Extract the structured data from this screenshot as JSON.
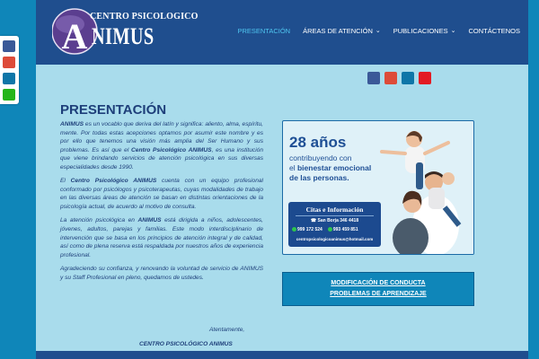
{
  "header": {
    "logo": {
      "line1": "CENTRO PSICOLOGICO",
      "line2": "NIMUS",
      "monogram": "A"
    },
    "nav": [
      {
        "label": "PRESENTACIÓN",
        "active": true
      },
      {
        "label": "ÁREAS DE ATENCIÓN",
        "dropdown": true
      },
      {
        "label": "PUBLICACIONES",
        "dropdown": true
      },
      {
        "label": "CONTÁCTENOS"
      }
    ]
  },
  "social": {
    "icons": [
      "facebook-icon",
      "google-plus-icon",
      "linkedin-icon",
      "youtube-icon"
    ],
    "colors": [
      "#3b5998",
      "#dd4b39",
      "#0e76a8",
      "#e31b23"
    ]
  },
  "share_bar": {
    "icons": [
      "facebook-icon",
      "google-plus-icon",
      "linkedin-icon",
      "whatsapp-icon"
    ],
    "colors": [
      "#3b5998",
      "#dd4b39",
      "#0e76a8",
      "#25b51a"
    ]
  },
  "main": {
    "heading": "PRESENTACIÓN",
    "p1_a": "ANIMUS",
    "p1_b": " es un vocablo que deriva del latín y significa: aliento, alma, espíritu, mente. Por todas estas acepciones optamos por asumir este nombre y es por ello que tenemos una visión más amplia del  Ser Humano y sus problemas.  Es así que el ",
    "p1_c": "Centro Psicológico ANIMUS",
    "p1_d": ", es una institución que viene brindando servicios de atención psicológica en sus diversas especialidades desde 1990.",
    "p2_a": "El ",
    "p2_b": "Centro Psicológico ANIMUS",
    "p2_c": " cuenta con un equipo profesional conformado por psicólogos y psicoterapeutas, cuyas modalidades de trabajo en las diversas áreas de atención se basan en distintas orientaciones de la psicología actual, de acuerdo al motivo de consulta.",
    "p3_a": "La atención psicológica en ",
    "p3_b": "ANIMUS",
    "p3_c": " está dirigida a niños, adolescentes, jóvenes, adultos, parejas y familias. Este modo interdisciplinario de  intervención  que se basa en los  principios de  atención  integral y de calidad,    así como de plena reserva  está  respaldada por nuestros años de experiencia profesional.",
    "p4": " Agradeciendo su confianza, y renovando la voluntad de servicio de ANIMUS y su Staff Profesional en pleno, quedamos de ustedes.",
    "closing": "Atentamente,",
    "signature": "CENTRO PSICOLÓGICO ANIMUS"
  },
  "promo": {
    "years": "28 años",
    "line1": "contribuyendo con",
    "line2_a": "el ",
    "line2_b": "bienestar emocional",
    "line3": "de las personas.",
    "citas": {
      "title": "Citas e Información",
      "address": "San Borja 346 4418",
      "phone1": "999 172 524",
      "phone2": "993 459 851",
      "email": "centropsicologicoanimus@hotmail.com"
    }
  },
  "buttons": {
    "conducta": "MODIFICACIÓN  DE CONDUCTA",
    "aprendizaje": "PROBLEMAS DE APRENDIZAJE"
  }
}
